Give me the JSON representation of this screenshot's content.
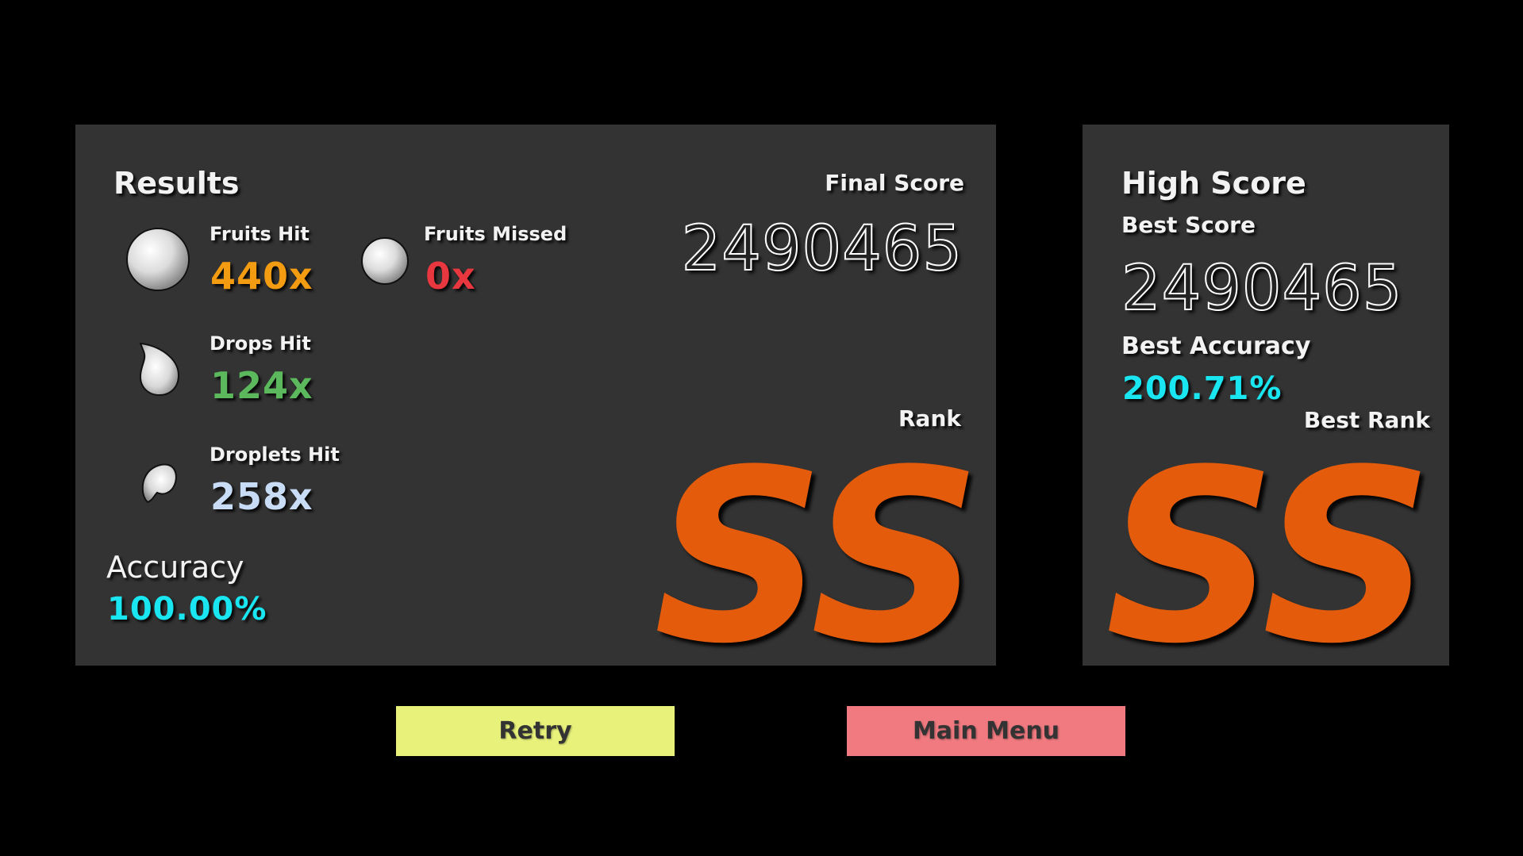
{
  "results": {
    "title": "Results",
    "fruits_hit": {
      "label": "Fruits Hit",
      "value": "440x"
    },
    "fruits_missed": {
      "label": "Fruits Missed",
      "value": "0x"
    },
    "drops_hit": {
      "label": "Drops Hit",
      "value": "124x"
    },
    "droplets_hit": {
      "label": "Droplets Hit",
      "value": "258x"
    },
    "accuracy_label": "Accuracy",
    "accuracy_value": "100.00%",
    "final_score_label": "Final Score",
    "final_score_value": "2490465",
    "rank_label": "Rank",
    "rank_value": "SS"
  },
  "high_score": {
    "title": "High Score",
    "best_score_label": "Best Score",
    "best_score_value": "2490465",
    "best_accuracy_label": "Best Accuracy",
    "best_accuracy_value": "200.71%",
    "best_rank_label": "Best Rank",
    "best_rank_value": "SS"
  },
  "buttons": {
    "retry": "Retry",
    "main_menu": "Main Menu"
  },
  "colors": {
    "panel_bg": "#333333",
    "fruits_hit": "#f39c12",
    "fruits_missed": "#e8373f",
    "drops_hit": "#5cb85c",
    "droplets_hit": "#c8dcf5",
    "accuracy": "#19e6f0",
    "rank": "#e35b0b",
    "retry_button": "#e8f27b",
    "main_menu_button": "#f07a80"
  },
  "icons": {
    "fruit": "fruit-ball-icon",
    "drop": "drop-icon",
    "droplet": "droplet-icon"
  }
}
